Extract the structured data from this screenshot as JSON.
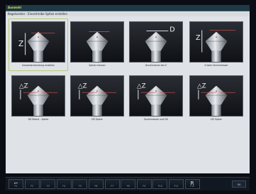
{
  "window": {
    "title": "Auswahl"
  },
  "breadcrumb": "Kegelsenker · Einseitreibe Spitze erstellen",
  "tiles": [
    {
      "caption": "Gesamtanwendung erstellen",
      "selected": true,
      "icon": "countersink-z-icon"
    },
    {
      "caption": "Spitze messen",
      "selected": false,
      "icon": "countersink-tip-icon"
    },
    {
      "caption": "Durchmesser bei Z",
      "selected": false,
      "icon": "countersink-diameter-icon"
    },
    {
      "caption": "Z beim Durchmesser",
      "selected": false,
      "icon": "countersink-z-diameter-icon"
    },
    {
      "caption": "DZ Ebene - Spitze",
      "selected": false,
      "icon": "delta-z-plane-icon"
    },
    {
      "caption": "DZ Spitze",
      "selected": false,
      "icon": "delta-z-tip-icon"
    },
    {
      "caption": "Durchmesser und DZ",
      "selected": false,
      "icon": "delta-z-diameter-icon"
    },
    {
      "caption": "DZ Spitze",
      "selected": false,
      "icon": "delta-z-tip-icon"
    }
  ],
  "softkeys": [
    {
      "label": "F1",
      "glyph_icon": "tool-probe-icon",
      "glyph": "⌐"
    },
    {
      "label": "F2",
      "glyph": ""
    },
    {
      "label": "F3",
      "glyph": ""
    },
    {
      "label": "F4",
      "glyph": ""
    },
    {
      "label": "F5",
      "glyph": ""
    },
    {
      "label": "F6",
      "glyph": ""
    },
    {
      "label": "F7",
      "glyph": ""
    },
    {
      "label": "F8",
      "glyph": ""
    },
    {
      "label": "F9",
      "glyph": ""
    },
    {
      "label": "F10",
      "glyph": ""
    },
    {
      "label": "F11",
      "glyph": ""
    },
    {
      "label": "F12",
      "glyph_icon": "return-icon",
      "glyph": "R"
    }
  ],
  "ok_label": "OK",
  "colors": {
    "title_text": "#e8d84a",
    "selection": "#b9cd78",
    "workspace": "#dfe3e7",
    "accent_red": "#d9534f"
  }
}
